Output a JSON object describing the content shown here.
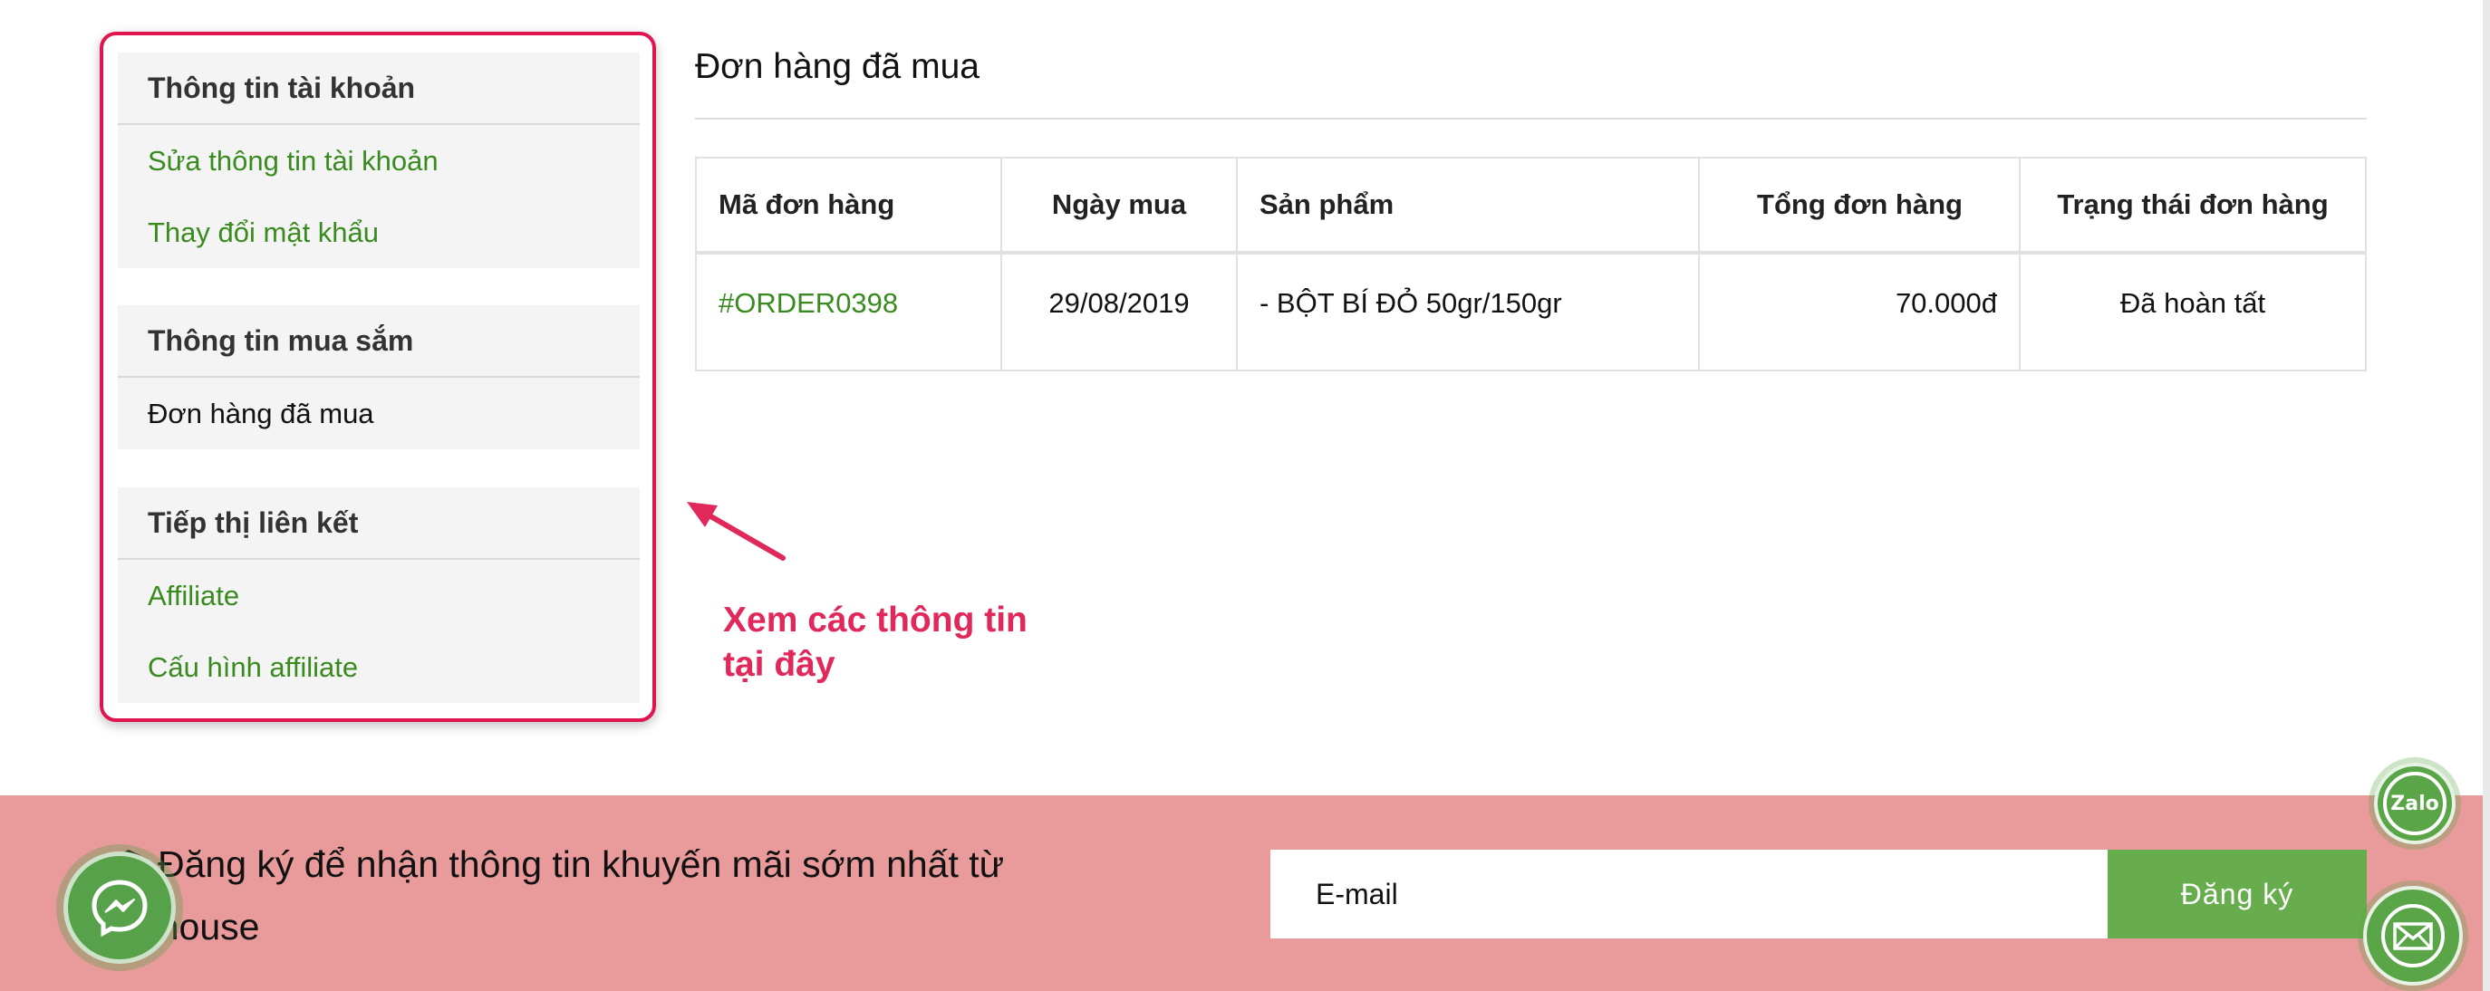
{
  "sidebar": {
    "groups": [
      {
        "heading": "Thông tin tài khoản",
        "items": [
          "Sửa thông tin tài khoản",
          "Thay đổi mật khẩu"
        ]
      },
      {
        "heading": "Thông tin mua sắm",
        "items": [
          "Đơn hàng đã mua"
        ]
      },
      {
        "heading": "Tiếp thị liên kết",
        "items": [
          "Affiliate",
          "Cấu hình affiliate"
        ]
      }
    ],
    "active_item": "Đơn hàng đã mua",
    "highlight_color": "#e0144e",
    "link_color": "#3a8b1f"
  },
  "main": {
    "title": "Đơn hàng đã mua",
    "table": {
      "headers": [
        "Mã đơn hàng",
        "Ngày mua",
        "Sản phẩm",
        "Tổng đơn hàng",
        "Trạng thái đơn hàng"
      ],
      "rows": [
        {
          "order_id": "#ORDER0398",
          "date": "29/08/2019",
          "product": "- BỘT BÍ ĐỎ 50gr/150gr",
          "total": "70.000đ",
          "status": "Đã hoàn tất"
        }
      ]
    }
  },
  "annotation": {
    "line1": "Xem các thông tin",
    "line2": "tại đây",
    "color": "#e0285a"
  },
  "newsletter": {
    "text": "Đăng ký để nhận thông tin khuyến mãi sớm nhất từ alahouse",
    "email_placeholder": "E-mail",
    "button_label": "Đăng ký",
    "background": "#e99a9b",
    "button_color": "#68ad4d",
    "icon": "graduation-cap-icon"
  },
  "floating": {
    "zalo_label": "Zalo",
    "icons": [
      "messenger-icon",
      "zalo-icon",
      "mail-icon"
    ]
  }
}
